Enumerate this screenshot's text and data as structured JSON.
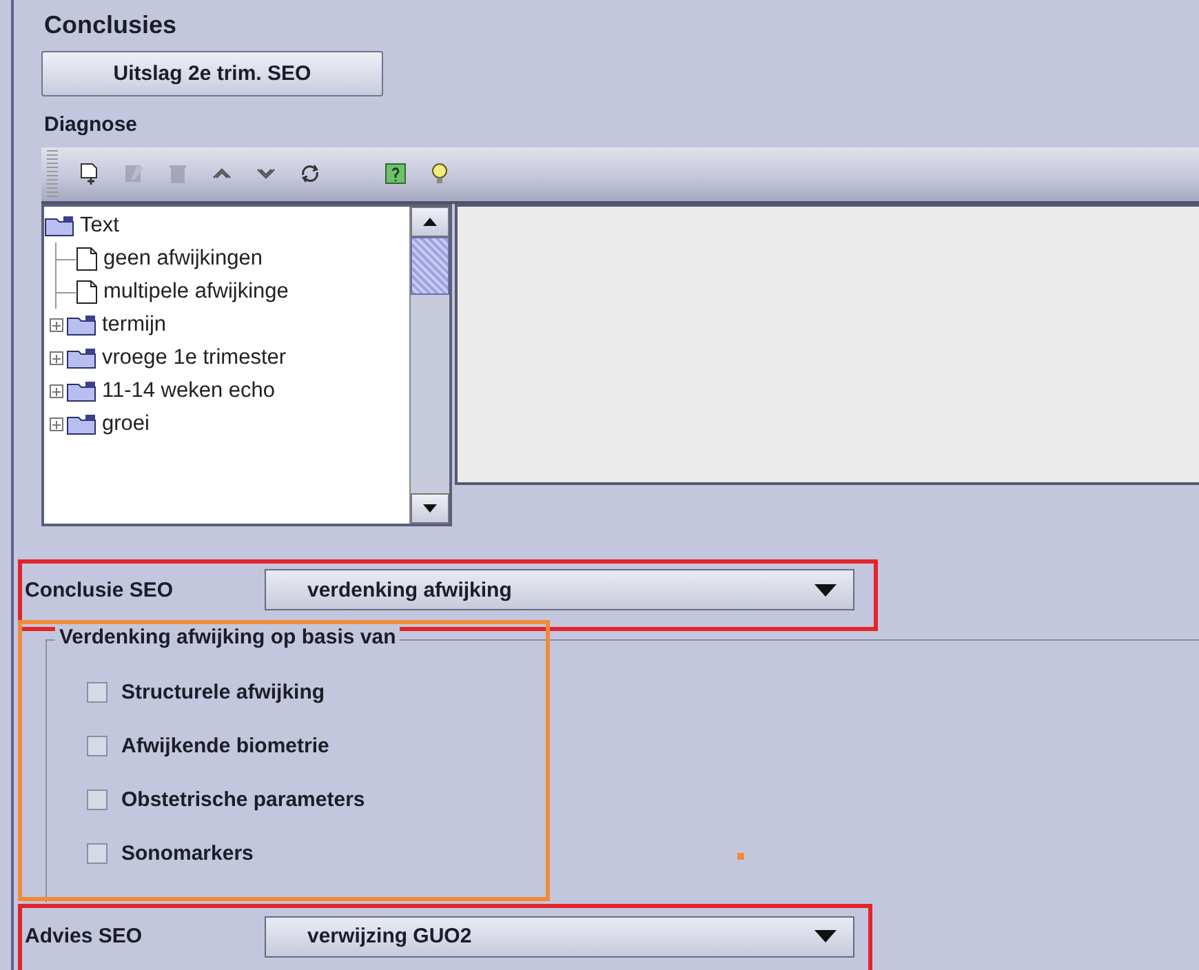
{
  "title": "Conclusies",
  "result_button": "Uitslag 2e trim. SEO",
  "diagnose": {
    "label": "Diagnose",
    "toolbar": [
      {
        "kind": "new",
        "disabled": false
      },
      {
        "kind": "edit",
        "disabled": true
      },
      {
        "kind": "delete",
        "disabled": true
      },
      {
        "kind": "up",
        "disabled": false
      },
      {
        "kind": "down",
        "disabled": false
      },
      {
        "kind": "refresh",
        "disabled": false
      },
      {
        "kind": "help",
        "disabled": false
      },
      {
        "kind": "hint",
        "disabled": false
      }
    ],
    "tree": [
      {
        "label": "Text",
        "kind": "folder",
        "expanded": true,
        "children": [
          {
            "label": "geen afwijkingen",
            "kind": "document"
          },
          {
            "label": "multipele afwijkinge",
            "kind": "document"
          }
        ]
      },
      {
        "label": "termijn",
        "kind": "folder",
        "expanded": false
      },
      {
        "label": "vroege 1e trimester",
        "kind": "folder",
        "expanded": false
      },
      {
        "label": "11-14 weken echo",
        "kind": "folder",
        "expanded": false
      },
      {
        "label": "groei",
        "kind": "folder",
        "expanded": false
      }
    ]
  },
  "conclusie": {
    "label": "Conclusie SEO",
    "value": "verdenking afwijking",
    "highlight": {
      "color": "#e3242b"
    }
  },
  "basis": {
    "legend": "Verdenking afwijking op basis van",
    "highlight": {
      "color": "#f28a3a"
    },
    "options": [
      {
        "label": "Structurele afwijking",
        "checked": false
      },
      {
        "label": "Afwijkende biometrie",
        "checked": false
      },
      {
        "label": "Obstetrische parameters",
        "checked": false
      },
      {
        "label": "Sonomarkers",
        "checked": false
      }
    ]
  },
  "advies": {
    "label": "Advies SEO",
    "value": "verwijzing GUO2",
    "highlight": {
      "color": "#e3242b"
    }
  }
}
